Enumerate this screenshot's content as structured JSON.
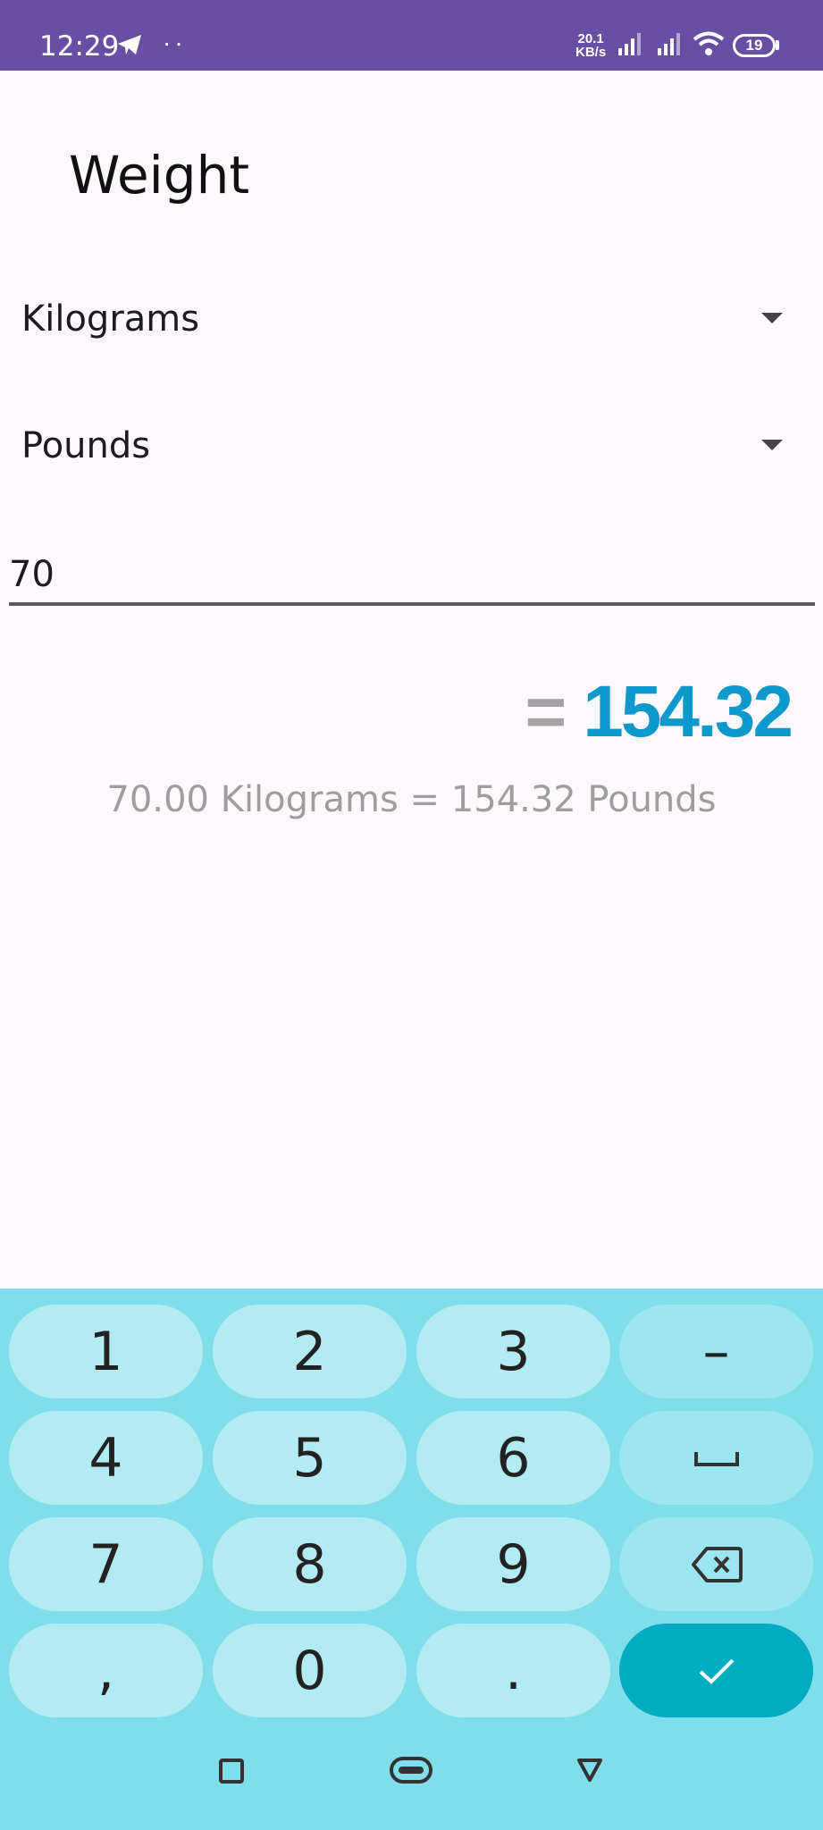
{
  "status_bar": {
    "time": "12:29",
    "dots": "··",
    "net_speed_value": "20.1",
    "net_speed_unit": "KB/s",
    "battery": "19",
    "color": "#6750a4"
  },
  "page": {
    "title": "Weight"
  },
  "converter": {
    "from_unit": "Kilograms",
    "to_unit": "Pounds",
    "input_value": "70",
    "equals": "=",
    "result": "154.32",
    "summary": "70.00 Kilograms = 154.32 Pounds",
    "result_color": "#0d99cc"
  },
  "keyboard": {
    "keys": [
      "1",
      "2",
      "3",
      "–",
      "4",
      "5",
      "6",
      "7",
      "8",
      "9",
      ",",
      "0",
      "."
    ],
    "icons": [
      "space-icon",
      "backspace-icon",
      "checkmark-icon"
    ],
    "done_color": "#00acc1"
  },
  "nav_bar": {
    "icons": [
      "recents-icon",
      "home-icon",
      "back-icon"
    ]
  }
}
